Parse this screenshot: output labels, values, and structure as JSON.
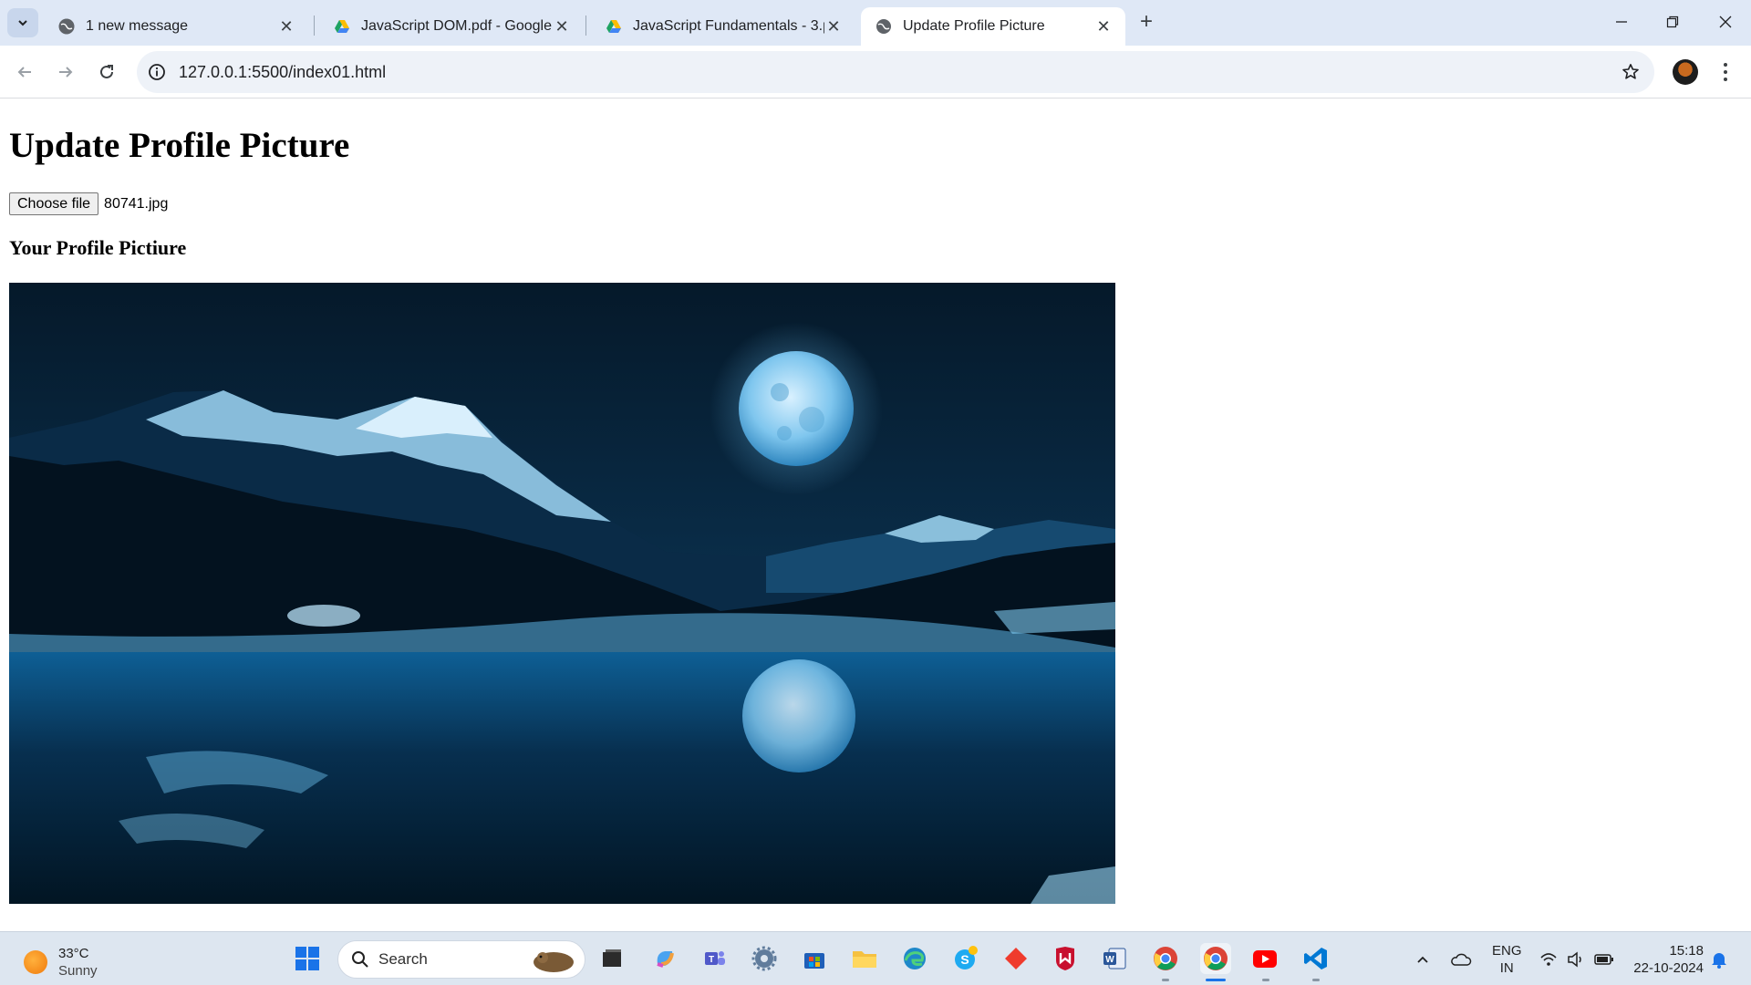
{
  "browser": {
    "tabs": [
      {
        "label": "1 new message",
        "active": false
      },
      {
        "label": "JavaScript DOM.pdf - Google D",
        "active": false
      },
      {
        "label": "JavaScript Fundamentals - 3.pd",
        "active": false
      },
      {
        "label": "Update Profile Picture",
        "active": true
      }
    ],
    "url": "127.0.0.1:5500/index01.html"
  },
  "page": {
    "title": "Update Profile Picture",
    "file_button_label": "Choose file",
    "file_name": "80741.jpg",
    "subtitle": "Your Profile Pictiure",
    "image_subject": "moonlit-mountain-lake"
  },
  "taskbar": {
    "weather_temp": "33°C",
    "weather_condition": "Sunny",
    "search_label": "Search",
    "language": "ENG",
    "region": "IN",
    "time": "15:18",
    "date": "22-10-2024"
  },
  "colors": {
    "tabstrip": "#dfe8f6",
    "accent": "#1a73e8",
    "taskbar": "#dde6f0"
  }
}
